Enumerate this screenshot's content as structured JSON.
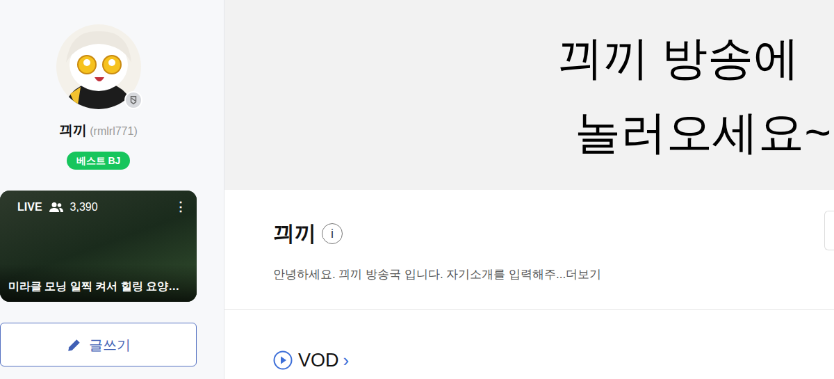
{
  "sidebar": {
    "name": "끠끼",
    "user_id": "(rmlrl771)",
    "badge": "베스트 BJ",
    "live": {
      "label": "LIVE",
      "viewers": "3,390",
      "menu": "⋮",
      "title": "미라클 모닝 일찍 켜서 힐링 요양…"
    },
    "write_button": "글쓰기"
  },
  "banner": {
    "lines": [
      "끠끼 방송에",
      "놀러오세요~"
    ]
  },
  "channel": {
    "title": "끠끼",
    "info": "i",
    "description": "안녕하세요. 끠끼 방송국 입니다. 자기소개를 입력해주...",
    "more": "더보기"
  },
  "sections": [
    {
      "label": "VOD",
      "arrow": "›"
    }
  ]
}
